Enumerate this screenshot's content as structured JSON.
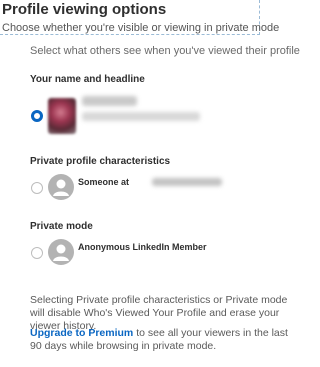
{
  "header": {
    "title": "Profile viewing options",
    "subtitle": "Choose whether you're visible or viewing in private mode"
  },
  "intro": "Select what others see when you've viewed their profile",
  "options": [
    {
      "section_title": "Your name and headline",
      "selected": true,
      "avatar": "blurred-profile-photo",
      "label": ""
    },
    {
      "section_title": "Private profile characteristics",
      "selected": false,
      "avatar": "generic-person-icon",
      "label": "Someone at"
    },
    {
      "section_title": "Private mode",
      "selected": false,
      "avatar": "generic-person-icon",
      "label": "Anonymous LinkedIn Member"
    }
  ],
  "footer": {
    "disclaimer": "Selecting Private profile characteristics or Private mode will disable Who's Viewed Your Profile and erase your viewer history.",
    "premium_link": "Upgrade to Premium",
    "premium_text": " to see all your viewers in the last 90 days while browsing in private mode."
  },
  "colors": {
    "accent": "#0a66c2",
    "avatar_gray": "#b3b3b3"
  }
}
